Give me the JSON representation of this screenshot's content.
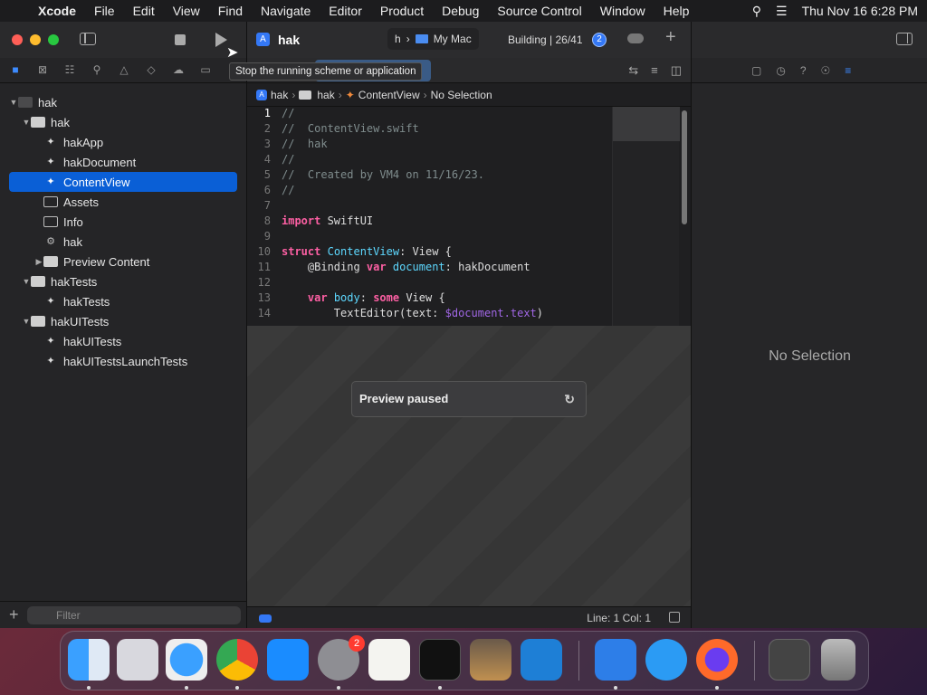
{
  "menubar": {
    "app": "Xcode",
    "items": [
      "File",
      "Edit",
      "View",
      "Find",
      "Navigate",
      "Editor",
      "Product",
      "Debug",
      "Source Control",
      "Window",
      "Help"
    ],
    "datetime": "Thu Nov 16  6:28 PM"
  },
  "toolbar": {
    "project": "hak",
    "scheme": "h",
    "destination": "My Mac",
    "status": "Building | 26/41",
    "issue_count": "2",
    "tooltip": "Stop the running scheme or application"
  },
  "navigator": {
    "items": [
      {
        "label": "hak",
        "level": 0,
        "kind": "project",
        "expanded": true
      },
      {
        "label": "hak",
        "level": 1,
        "kind": "folder",
        "expanded": true
      },
      {
        "label": "hakApp",
        "level": 2,
        "kind": "swift"
      },
      {
        "label": "hakDocument",
        "level": 2,
        "kind": "swift"
      },
      {
        "label": "ContentView",
        "level": 2,
        "kind": "swift",
        "selected": true
      },
      {
        "label": "Assets",
        "level": 2,
        "kind": "assets"
      },
      {
        "label": "Info",
        "level": 2,
        "kind": "plist"
      },
      {
        "label": "hak",
        "level": 2,
        "kind": "entitlements"
      },
      {
        "label": "Preview Content",
        "level": 2,
        "kind": "folder",
        "expanded": false
      },
      {
        "label": "hakTests",
        "level": 1,
        "kind": "folder",
        "expanded": true
      },
      {
        "label": "hakTests",
        "level": 2,
        "kind": "swift"
      },
      {
        "label": "hakUITests",
        "level": 1,
        "kind": "folder",
        "expanded": true
      },
      {
        "label": "hakUITests",
        "level": 2,
        "kind": "swift"
      },
      {
        "label": "hakUITestsLaunchTests",
        "level": 2,
        "kind": "swift"
      }
    ],
    "filter_placeholder": "Filter"
  },
  "jumpbar": [
    "hak",
    "hak",
    "ContentView",
    "No Selection"
  ],
  "code": [
    {
      "n": "1",
      "t": "//",
      "k": "com"
    },
    {
      "n": "2",
      "t": "//  ContentView.swift",
      "k": "com"
    },
    {
      "n": "3",
      "t": "//  hak",
      "k": "com"
    },
    {
      "n": "4",
      "t": "//",
      "k": "com"
    },
    {
      "n": "5",
      "t": "//  Created by VM4 on 11/16/23.",
      "k": "com"
    },
    {
      "n": "6",
      "t": "//",
      "k": "com"
    },
    {
      "n": "7",
      "t": "",
      "k": "plain"
    },
    {
      "n": "8",
      "t": "import SwiftUI",
      "k": "import"
    },
    {
      "n": "9",
      "t": "",
      "k": "plain"
    },
    {
      "n": "10",
      "t": "struct ContentView: View {",
      "k": "struct"
    },
    {
      "n": "11",
      "t": "    @Binding var document: hakDocument",
      "k": "binding"
    },
    {
      "n": "12",
      "t": "",
      "k": "plain"
    },
    {
      "n": "13",
      "t": "    var body: some View {",
      "k": "body"
    },
    {
      "n": "14",
      "t": "        TextEditor(text: $document.text)",
      "k": "editor"
    }
  ],
  "preview": {
    "message": "Preview paused"
  },
  "statusbar": {
    "position": "Line: 1  Col: 1"
  },
  "inspector": {
    "empty": "No Selection"
  },
  "dock": {
    "apps": [
      "Finder",
      "Launchpad",
      "Safari",
      "Chrome",
      "App Store",
      "System Settings",
      "TextEdit",
      "Terminal",
      "Instruments",
      "Visual Studio Code",
      "Xcode",
      "TestFlight",
      "Firefox",
      "Screenshot",
      "Trash"
    ],
    "settings_badge": "2"
  }
}
